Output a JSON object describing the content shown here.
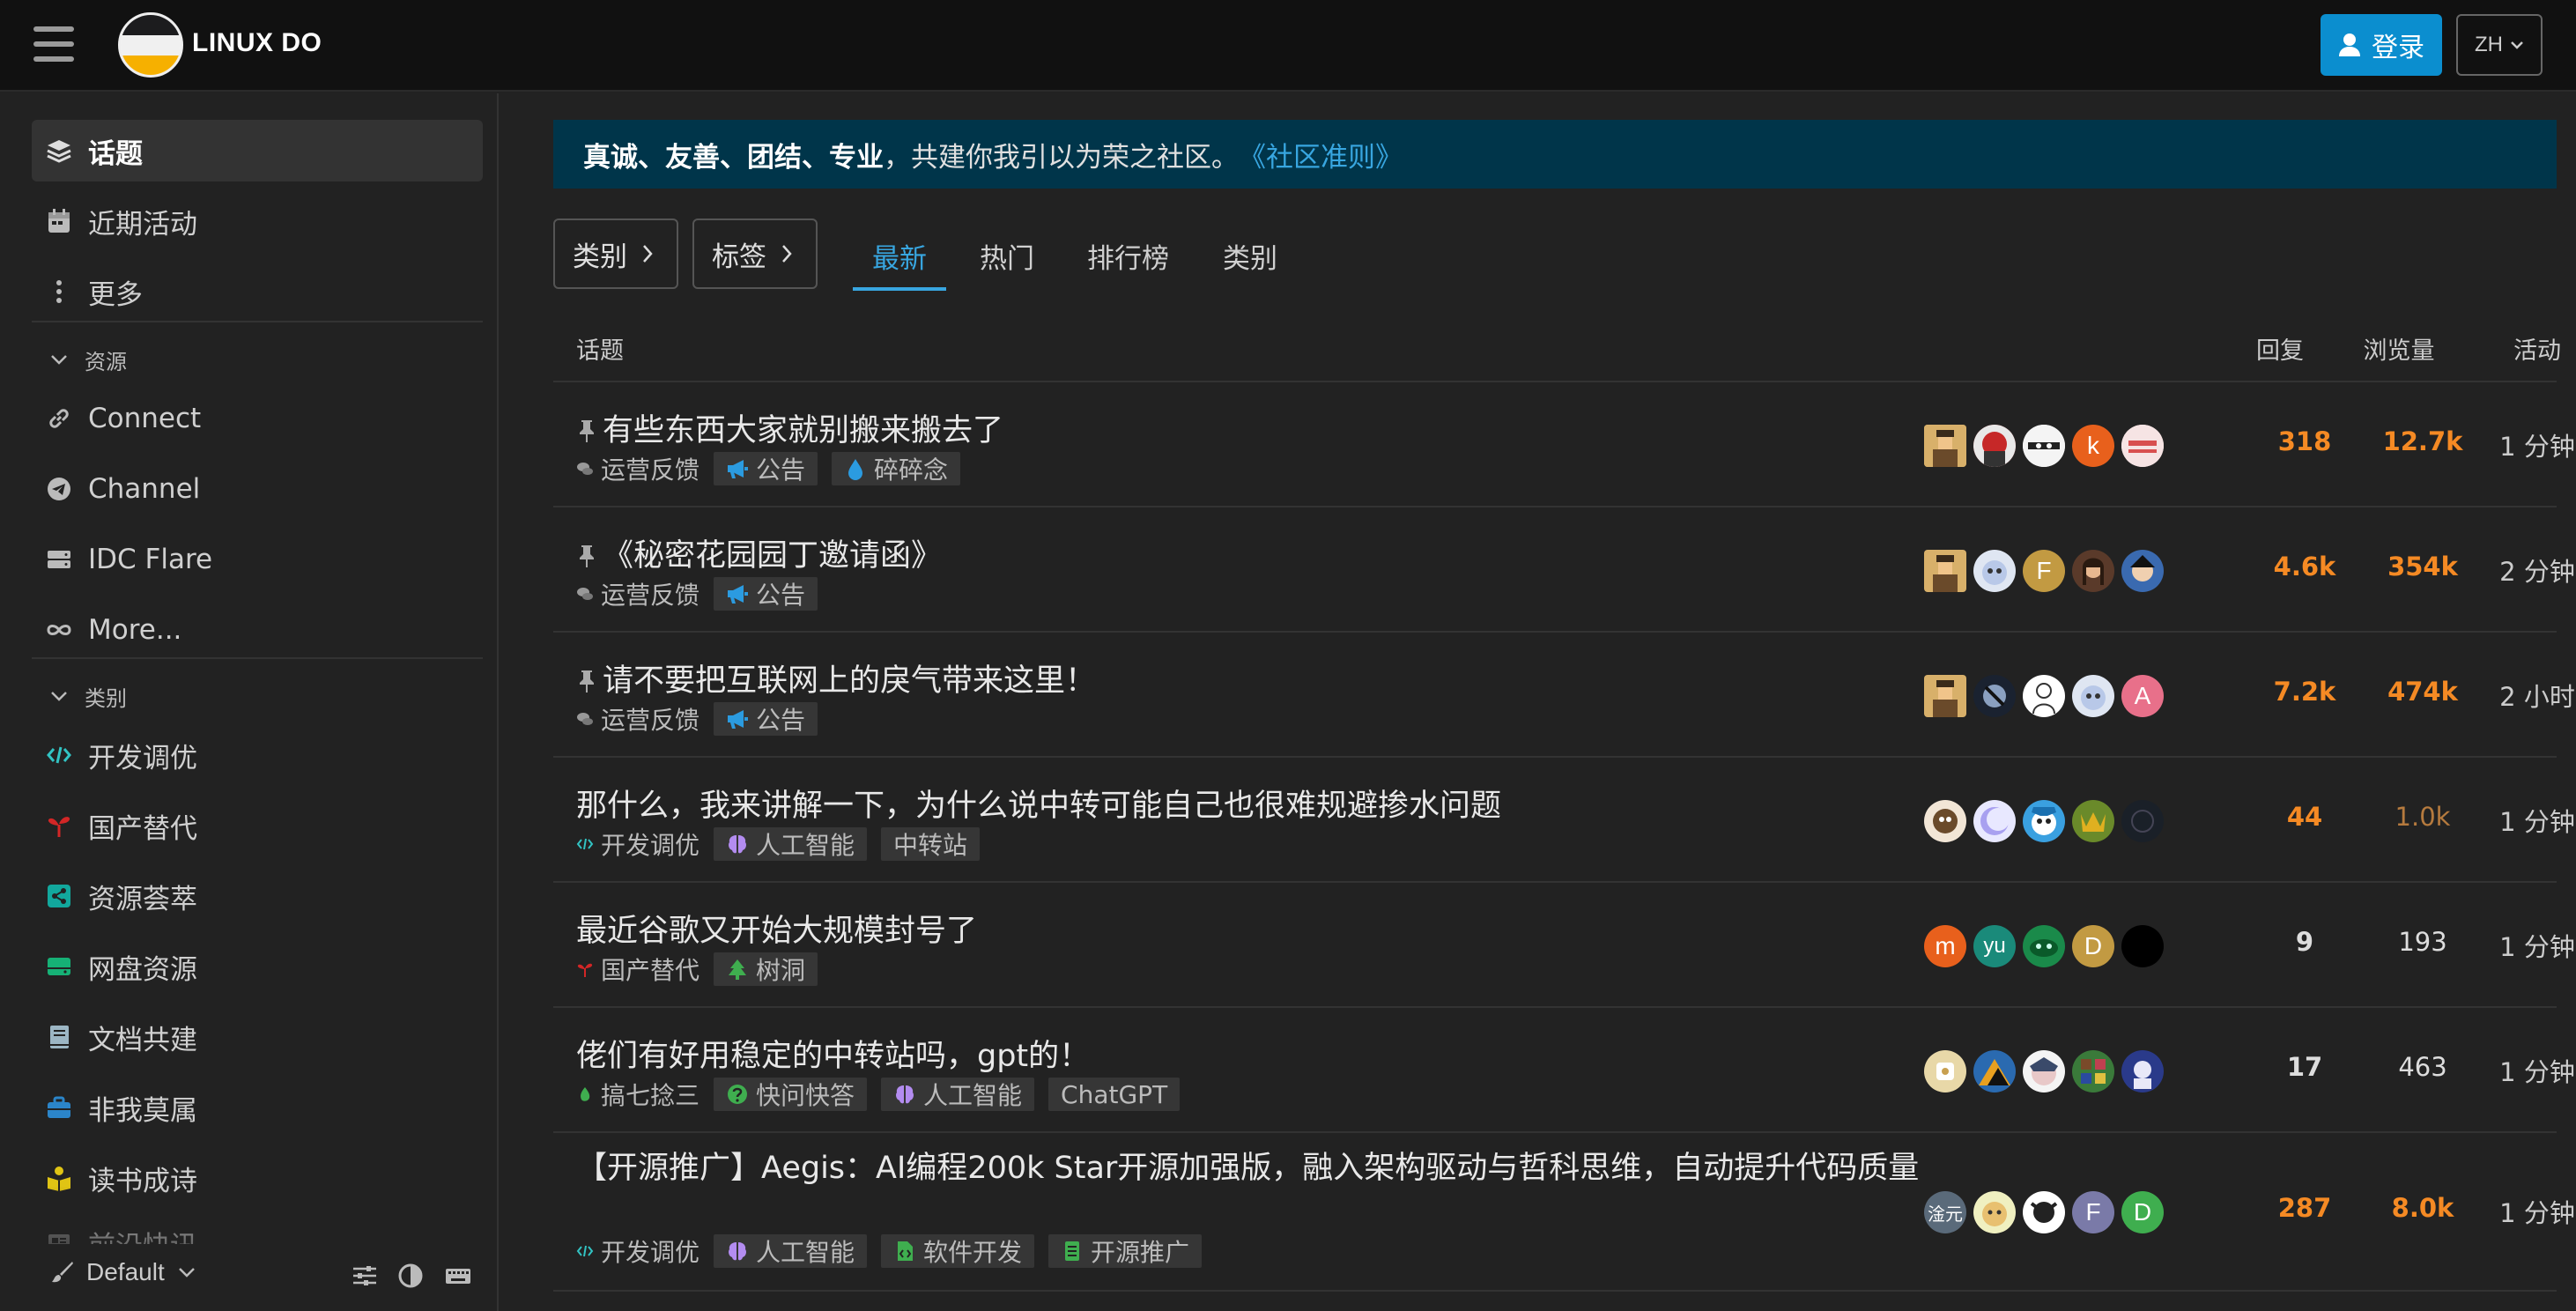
{
  "header": {
    "site_name": "LINUX DO",
    "login_label": "登录",
    "lang_label": "ZH"
  },
  "sidebar": {
    "main_items": [
      {
        "label": "话题",
        "icon": "layers-icon",
        "active": true
      },
      {
        "label": "近期活动",
        "icon": "calendar-icon"
      },
      {
        "label": "更多",
        "icon": "more-vertical-icon"
      }
    ],
    "resources_title": "资源",
    "resources": [
      {
        "label": "Connect",
        "icon": "link-icon"
      },
      {
        "label": "Channel",
        "icon": "telegram-icon"
      },
      {
        "label": "IDC Flare",
        "icon": "server-icon"
      },
      {
        "label": "More...",
        "icon": "infinity-icon"
      }
    ],
    "categories_title": "类别",
    "categories": [
      {
        "label": "开发调优",
        "icon": "code-icon",
        "color": "#32c3c3"
      },
      {
        "label": "国产替代",
        "icon": "sprout-icon",
        "color": "#d32626"
      },
      {
        "label": "资源荟萃",
        "icon": "share-icon",
        "color": "#12a89d"
      },
      {
        "label": "网盘资源",
        "icon": "hard-drive-icon",
        "color": "#16b176"
      },
      {
        "label": "文档共建",
        "icon": "book-icon",
        "color": "#9cb6c4"
      },
      {
        "label": "非我莫属",
        "icon": "briefcase-icon",
        "color": "#2b85c9"
      },
      {
        "label": "读书成诗",
        "icon": "reader-icon",
        "color": "#e0c414"
      },
      {
        "label": "前沿快讯",
        "icon": "newspaper-icon",
        "color": "#bbbbbb"
      }
    ],
    "theme_label": "Default"
  },
  "banner": {
    "bold_text": "真诚、友善、团结、专业",
    "text": "，共建你我引以为荣之社区。",
    "link": "《社区准则》"
  },
  "filters": {
    "category_label": "类别",
    "tag_label": "标签"
  },
  "tabs": [
    {
      "label": "最新",
      "active": true
    },
    {
      "label": "热门"
    },
    {
      "label": "排行榜"
    },
    {
      "label": "类别"
    }
  ],
  "table_headers": {
    "topic": "话题",
    "replies": "回复",
    "views": "浏览量",
    "activity": "活动"
  },
  "topics": [
    {
      "title": "有些东西大家就别搬来搬去了",
      "pinned": true,
      "category": "运营反馈",
      "tags": [
        "公告",
        "碎碎念"
      ],
      "replies": "318",
      "views": "12.7k",
      "activity": "1 分钟"
    },
    {
      "title": "《秘密花园园丁邀请函》",
      "pinned": true,
      "category": "运营反馈",
      "tags": [
        "公告"
      ],
      "replies": "4.6k",
      "views": "354k",
      "activity": "2 分钟"
    },
    {
      "title": "请不要把互联网上的戾气带来这里！",
      "pinned": true,
      "category": "运营反馈",
      "tags": [
        "公告"
      ],
      "replies": "7.2k",
      "views": "474k",
      "activity": "2 小时"
    },
    {
      "title": "那什么，我来讲解一下，为什么说中转可能自己也很难规避掺水问题",
      "pinned": false,
      "category": "开发调优",
      "tags": [
        "人工智能",
        "中转站"
      ],
      "replies": "44",
      "views": "1.0k",
      "activity": "1 分钟"
    },
    {
      "title": "最近谷歌又开始大规模封号了",
      "pinned": false,
      "category": "国产替代",
      "tags": [
        "树洞"
      ],
      "replies": "9",
      "views": "193",
      "activity": "1 分钟"
    },
    {
      "title": "佬们有好用稳定的中转站吗，gpt的！",
      "pinned": false,
      "category": "搞七捻三",
      "tags": [
        "快问快答",
        "人工智能",
        "ChatGPT"
      ],
      "replies": "17",
      "views": "463",
      "activity": "1 分钟"
    },
    {
      "title": "【开源推广】Aegis：AI编程200k Star开源加强版，融入架构驱动与哲科思维，自动提升代码质量",
      "pinned": false,
      "category": "开发调优",
      "tags": [
        "人工智能",
        "软件开发",
        "开源推广"
      ],
      "replies": "287",
      "views": "8.0k",
      "activity": "1 分钟"
    }
  ],
  "avatar_letters": {
    "r1": "k",
    "r2": "F",
    "r3": "A",
    "r5a": "m",
    "r5b": "yu",
    "r5c": "D",
    "r7a": "淦元",
    "r7b": "F",
    "r7c": "D"
  },
  "colors": {
    "accent": "#38a6e0",
    "login_bg": "#0b8ecf",
    "banner_bg": "#00354a",
    "hot_number": "#f58a24",
    "warm_number": "#b57a3e"
  }
}
